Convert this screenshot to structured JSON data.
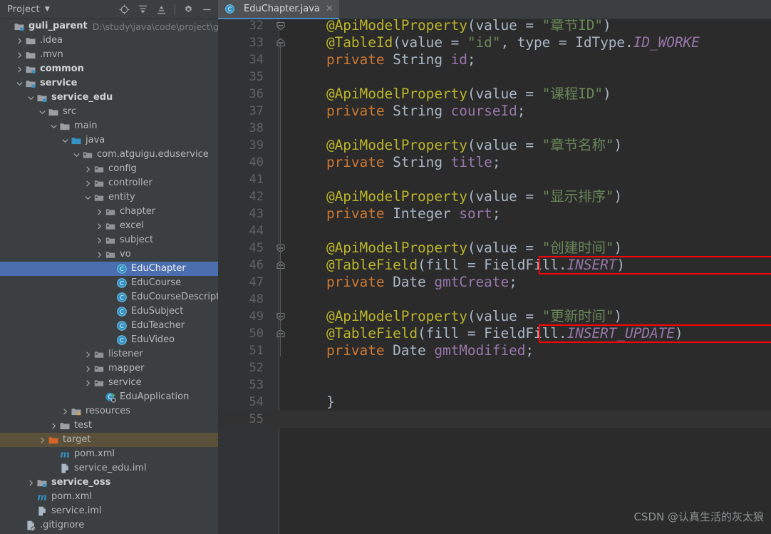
{
  "sidebar": {
    "title": "Project",
    "caret_icon": "chevron-down-icon",
    "tools": [
      {
        "name": "locate-icon",
        "label": "Select Opened File"
      },
      {
        "name": "expand-all-icon",
        "label": "Expand All"
      },
      {
        "name": "collapse-all-icon",
        "label": "Collapse All"
      },
      {
        "name": "gear-icon",
        "label": "Settings"
      },
      {
        "name": "minimize-icon",
        "label": "Hide"
      }
    ],
    "tree": [
      {
        "label": "guli_parent",
        "path": "D:\\study\\java\\code\\project\\guli_pare",
        "indent": 0,
        "arrow": "none",
        "icon": "module-folder-icon",
        "bold": true,
        "state": "normal"
      },
      {
        "label": ".idea",
        "indent": 1,
        "arrow": "right",
        "icon": "folder-icon",
        "bold": false,
        "state": "normal"
      },
      {
        "label": ".mvn",
        "indent": 1,
        "arrow": "right",
        "icon": "folder-icon",
        "bold": false,
        "state": "normal"
      },
      {
        "label": "common",
        "indent": 1,
        "arrow": "right",
        "icon": "module-folder-icon",
        "bold": true,
        "state": "normal"
      },
      {
        "label": "service",
        "indent": 1,
        "arrow": "down",
        "icon": "module-folder-icon",
        "bold": true,
        "state": "normal"
      },
      {
        "label": "service_edu",
        "indent": 2,
        "arrow": "down",
        "icon": "module-folder-icon",
        "bold": true,
        "state": "normal"
      },
      {
        "label": "src",
        "indent": 3,
        "arrow": "down",
        "icon": "folder-icon",
        "bold": false,
        "state": "normal"
      },
      {
        "label": "main",
        "indent": 4,
        "arrow": "down",
        "icon": "folder-icon",
        "bold": false,
        "state": "normal"
      },
      {
        "label": "java",
        "indent": 5,
        "arrow": "down",
        "icon": "source-folder-icon",
        "bold": false,
        "state": "normal"
      },
      {
        "label": "com.atguigu.eduservice",
        "indent": 6,
        "arrow": "down",
        "icon": "package-icon",
        "bold": false,
        "state": "normal"
      },
      {
        "label": "config",
        "indent": 7,
        "arrow": "right",
        "icon": "package-icon",
        "bold": false,
        "state": "normal"
      },
      {
        "label": "controller",
        "indent": 7,
        "arrow": "right",
        "icon": "package-icon",
        "bold": false,
        "state": "normal"
      },
      {
        "label": "entity",
        "indent": 7,
        "arrow": "down",
        "icon": "package-icon",
        "bold": false,
        "state": "normal"
      },
      {
        "label": "chapter",
        "indent": 8,
        "arrow": "right",
        "icon": "package-icon",
        "bold": false,
        "state": "normal"
      },
      {
        "label": "excel",
        "indent": 8,
        "arrow": "right",
        "icon": "package-icon",
        "bold": false,
        "state": "normal"
      },
      {
        "label": "subject",
        "indent": 8,
        "arrow": "right",
        "icon": "package-icon",
        "bold": false,
        "state": "normal"
      },
      {
        "label": "vo",
        "indent": 8,
        "arrow": "right",
        "icon": "package-icon",
        "bold": false,
        "state": "normal"
      },
      {
        "label": "EduChapter",
        "indent": 9,
        "arrow": "none",
        "icon": "java-class-icon",
        "bold": false,
        "state": "selected"
      },
      {
        "label": "EduCourse",
        "indent": 9,
        "arrow": "none",
        "icon": "java-class-icon",
        "bold": false,
        "state": "normal"
      },
      {
        "label": "EduCourseDescription",
        "indent": 9,
        "arrow": "none",
        "icon": "java-class-icon",
        "bold": false,
        "state": "normal"
      },
      {
        "label": "EduSubject",
        "indent": 9,
        "arrow": "none",
        "icon": "java-class-icon",
        "bold": false,
        "state": "normal"
      },
      {
        "label": "EduTeacher",
        "indent": 9,
        "arrow": "none",
        "icon": "java-class-icon",
        "bold": false,
        "state": "normal"
      },
      {
        "label": "EduVideo",
        "indent": 9,
        "arrow": "none",
        "icon": "java-class-icon",
        "bold": false,
        "state": "normal"
      },
      {
        "label": "listener",
        "indent": 7,
        "arrow": "right",
        "icon": "package-icon",
        "bold": false,
        "state": "normal"
      },
      {
        "label": "mapper",
        "indent": 7,
        "arrow": "right",
        "icon": "package-icon",
        "bold": false,
        "state": "normal"
      },
      {
        "label": "service",
        "indent": 7,
        "arrow": "right",
        "icon": "package-icon",
        "bold": false,
        "state": "normal"
      },
      {
        "label": "EduApplication",
        "indent": 8,
        "arrow": "none",
        "icon": "spring-boot-class-icon",
        "bold": false,
        "state": "normal"
      },
      {
        "label": "resources",
        "indent": 5,
        "arrow": "right",
        "icon": "resources-folder-icon",
        "bold": false,
        "state": "normal"
      },
      {
        "label": "test",
        "indent": 4,
        "arrow": "right",
        "icon": "folder-icon",
        "bold": false,
        "state": "normal"
      },
      {
        "label": "target",
        "indent": 3,
        "arrow": "right",
        "icon": "target-folder-icon",
        "bold": false,
        "state": "highlighted"
      },
      {
        "label": "pom.xml",
        "indent": 4,
        "arrow": "none",
        "icon": "maven-icon",
        "bold": false,
        "state": "normal"
      },
      {
        "label": "service_edu.iml",
        "indent": 4,
        "arrow": "none",
        "icon": "iml-file-icon",
        "bold": false,
        "state": "normal"
      },
      {
        "label": "service_oss",
        "indent": 2,
        "arrow": "right",
        "icon": "module-folder-icon",
        "bold": true,
        "state": "normal"
      },
      {
        "label": "pom.xml",
        "indent": 2,
        "arrow": "none",
        "icon": "maven-icon",
        "bold": false,
        "state": "normal"
      },
      {
        "label": "service.iml",
        "indent": 2,
        "arrow": "none",
        "icon": "iml-file-icon",
        "bold": false,
        "state": "normal"
      },
      {
        "label": ".gitignore",
        "indent": 1,
        "arrow": "none",
        "icon": "gitignore-file-icon",
        "bold": false,
        "state": "normal"
      }
    ]
  },
  "editor": {
    "tab": {
      "label": "EduChapter.java",
      "icon": "java-class-icon",
      "close_icon": "close-icon"
    },
    "first_line_number": 32,
    "lines": [
      {
        "n": 32,
        "fold": "end",
        "tokens": [
          {
            "t": "ann",
            "v": "@ApiModelProperty"
          },
          {
            "t": "plain",
            "v": "(value = "
          },
          {
            "t": "str",
            "v": "\"章节ID\""
          },
          {
            "t": "plain",
            "v": ")"
          }
        ]
      },
      {
        "n": 33,
        "fold": "start",
        "tokens": [
          {
            "t": "ann",
            "v": "@TableId"
          },
          {
            "t": "plain",
            "v": "(value = "
          },
          {
            "t": "str",
            "v": "\"id\""
          },
          {
            "t": "plain",
            "v": ", type = "
          },
          {
            "t": "cls",
            "v": "IdType."
          },
          {
            "t": "static",
            "v": "ID_WORKE"
          }
        ]
      },
      {
        "n": 34,
        "fold": "none",
        "tokens": [
          {
            "t": "kw",
            "v": "private"
          },
          {
            "t": "plain",
            "v": " "
          },
          {
            "t": "type",
            "v": "String"
          },
          {
            "t": "plain",
            "v": " "
          },
          {
            "t": "field",
            "v": "id"
          },
          {
            "t": "plain",
            "v": ";"
          }
        ]
      },
      {
        "n": 35,
        "fold": "none",
        "tokens": []
      },
      {
        "n": 36,
        "fold": "none",
        "tokens": [
          {
            "t": "ann",
            "v": "@ApiModelProperty"
          },
          {
            "t": "plain",
            "v": "(value = "
          },
          {
            "t": "str",
            "v": "\"课程ID\""
          },
          {
            "t": "plain",
            "v": ")"
          }
        ]
      },
      {
        "n": 37,
        "fold": "none",
        "tokens": [
          {
            "t": "kw",
            "v": "private"
          },
          {
            "t": "plain",
            "v": " "
          },
          {
            "t": "type",
            "v": "String"
          },
          {
            "t": "plain",
            "v": " "
          },
          {
            "t": "field",
            "v": "courseId"
          },
          {
            "t": "plain",
            "v": ";"
          }
        ]
      },
      {
        "n": 38,
        "fold": "none",
        "tokens": []
      },
      {
        "n": 39,
        "fold": "none",
        "tokens": [
          {
            "t": "ann",
            "v": "@ApiModelProperty"
          },
          {
            "t": "plain",
            "v": "(value = "
          },
          {
            "t": "str",
            "v": "\"章节名称\""
          },
          {
            "t": "plain",
            "v": ")"
          }
        ]
      },
      {
        "n": 40,
        "fold": "none",
        "tokens": [
          {
            "t": "kw",
            "v": "private"
          },
          {
            "t": "plain",
            "v": " "
          },
          {
            "t": "type",
            "v": "String"
          },
          {
            "t": "plain",
            "v": " "
          },
          {
            "t": "field",
            "v": "title"
          },
          {
            "t": "plain",
            "v": ";"
          }
        ]
      },
      {
        "n": 41,
        "fold": "none",
        "tokens": []
      },
      {
        "n": 42,
        "fold": "none",
        "tokens": [
          {
            "t": "ann",
            "v": "@ApiModelProperty"
          },
          {
            "t": "plain",
            "v": "(value = "
          },
          {
            "t": "str",
            "v": "\"显示排序\""
          },
          {
            "t": "plain",
            "v": ")"
          }
        ]
      },
      {
        "n": 43,
        "fold": "none",
        "tokens": [
          {
            "t": "kw",
            "v": "private"
          },
          {
            "t": "plain",
            "v": " "
          },
          {
            "t": "type",
            "v": "Integer"
          },
          {
            "t": "plain",
            "v": " "
          },
          {
            "t": "field",
            "v": "sort"
          },
          {
            "t": "plain",
            "v": ";"
          }
        ]
      },
      {
        "n": 44,
        "fold": "none",
        "tokens": []
      },
      {
        "n": 45,
        "fold": "end",
        "tokens": [
          {
            "t": "ann",
            "v": "@ApiModelProperty"
          },
          {
            "t": "plain",
            "v": "(value = "
          },
          {
            "t": "str",
            "v": "\"创建时间\""
          },
          {
            "t": "plain",
            "v": ")"
          }
        ]
      },
      {
        "n": 46,
        "fold": "start",
        "tokens": [
          {
            "t": "ann",
            "v": "@TableField"
          },
          {
            "t": "plain",
            "v": "(fill = "
          },
          {
            "t": "cls",
            "v": "FieldFill."
          },
          {
            "t": "static",
            "v": "INSERT"
          },
          {
            "t": "plain",
            "v": ")"
          }
        ]
      },
      {
        "n": 47,
        "fold": "none",
        "tokens": [
          {
            "t": "kw",
            "v": "private"
          },
          {
            "t": "plain",
            "v": " "
          },
          {
            "t": "type",
            "v": "Date"
          },
          {
            "t": "plain",
            "v": " "
          },
          {
            "t": "field",
            "v": "gmtCreate"
          },
          {
            "t": "plain",
            "v": ";"
          }
        ]
      },
      {
        "n": 48,
        "fold": "none",
        "tokens": []
      },
      {
        "n": 49,
        "fold": "end",
        "tokens": [
          {
            "t": "ann",
            "v": "@ApiModelProperty"
          },
          {
            "t": "plain",
            "v": "(value = "
          },
          {
            "t": "str",
            "v": "\"更新时间\""
          },
          {
            "t": "plain",
            "v": ")"
          }
        ]
      },
      {
        "n": 50,
        "fold": "start",
        "tokens": [
          {
            "t": "ann",
            "v": "@TableField"
          },
          {
            "t": "plain",
            "v": "(fill = "
          },
          {
            "t": "cls",
            "v": "FieldFill."
          },
          {
            "t": "static",
            "v": "INSERT_UPDATE"
          },
          {
            "t": "plain",
            "v": ")"
          }
        ]
      },
      {
        "n": 51,
        "fold": "none",
        "tokens": [
          {
            "t": "kw",
            "v": "private"
          },
          {
            "t": "plain",
            "v": " "
          },
          {
            "t": "type",
            "v": "Date"
          },
          {
            "t": "plain",
            "v": " "
          },
          {
            "t": "field",
            "v": "gmtModified"
          },
          {
            "t": "plain",
            "v": ";"
          }
        ]
      },
      {
        "n": 52,
        "fold": "none",
        "tokens": []
      },
      {
        "n": 53,
        "fold": "none",
        "tokens": []
      },
      {
        "n": 54,
        "fold": "none",
        "tokens": [
          {
            "t": "plain",
            "v": "}"
          }
        ]
      },
      {
        "n": 55,
        "fold": "none",
        "tokens": []
      }
    ],
    "current_line": 55,
    "annotations": [
      {
        "name": "highlight-box-insert",
        "line": 46,
        "color": "#FF0000"
      },
      {
        "name": "highlight-box-insert-update",
        "line": 50,
        "color": "#FF0000"
      }
    ]
  },
  "watermark": {
    "text": "CSDN @认真生活的灰太狼"
  },
  "colors": {
    "accent": "#4B6EAF",
    "annotation": "#BBB529",
    "keyword": "#CC7832",
    "string": "#6A8759",
    "field": "#9876AA",
    "plain": "#A9B7C6",
    "highlight_box": "#FF0000",
    "editor_bg": "#2B2B2B",
    "panel_bg": "#3C3F41"
  }
}
